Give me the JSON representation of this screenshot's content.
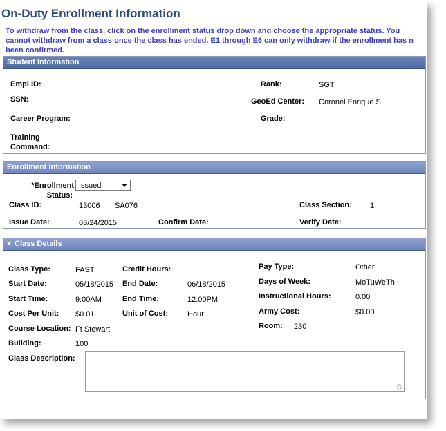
{
  "page": {
    "title": "On-Duty Enrollment Information",
    "instructions": [
      "To withdraw from the class, click on the enrollment status drop down and choose the appropriate status.  You",
      "cannot withdraw from a class once the class has ended.  E1 through E6 can only withdraw if the enrollment has n",
      "been confirmed."
    ]
  },
  "student": {
    "header": "Student Information",
    "empl_id_label": "Empl ID:",
    "ssn_label": "SSN:",
    "career_program_label": "Career Program:",
    "training_command_label_1": "Training",
    "training_command_label_2": "Command:",
    "rank_label": "Rank:",
    "rank_value": "SGT",
    "geoed_label": "GeoEd Center:",
    "geoed_value": "Coronel Enrique S",
    "grade_label": "Grade:"
  },
  "enrollment": {
    "header": "Enrollment Information",
    "status_label_1": "*Enrollment",
    "status_label_2": "Status:",
    "status_value": "Issued",
    "class_id_label": "Class ID:",
    "class_id_value": "13006",
    "class_code": "SA076",
    "class_section_label": "Class Section:",
    "class_section_value": "1",
    "issue_date_label": "Issue Date:",
    "issue_date_value": "03/24/2015",
    "confirm_date_label": "Confirm Date:",
    "verify_date_label": "Verify Date:"
  },
  "class_details": {
    "header": "Class Details",
    "class_type_label": "Class Type:",
    "class_type_value": "FAST",
    "start_date_label": "Start Date:",
    "start_date_value": "05/18/2015",
    "start_time_label": "Start Time:",
    "start_time_value": "9:00AM",
    "cost_per_unit_label": "Cost Per Unit:",
    "cost_per_unit_value": "$0.01",
    "course_location_label": "Course Location:",
    "course_location_value": "Ft Stewart",
    "building_label": "Building:",
    "building_value": "100",
    "class_description_label": "Class Description:",
    "credit_hours_label": "Credit Hours:",
    "end_date_label": "End Date:",
    "end_date_value": "06/18/2015",
    "end_time_label": "End Time:",
    "end_time_value": "12:00PM",
    "unit_of_cost_label": "Unit of Cost:",
    "unit_of_cost_value": "Hour",
    "pay_type_label": "Pay Type:",
    "pay_type_value": "Other",
    "days_of_week_label": "Days of Week:",
    "days_of_week_value": "MoTuWeTh",
    "instructional_hours_label": "Instructional Hours:",
    "instructional_hours_value": "0.00",
    "army_cost_label": "Army Cost:",
    "army_cost_value": "$0.00",
    "room_label": "Room:",
    "room_value": "230"
  }
}
